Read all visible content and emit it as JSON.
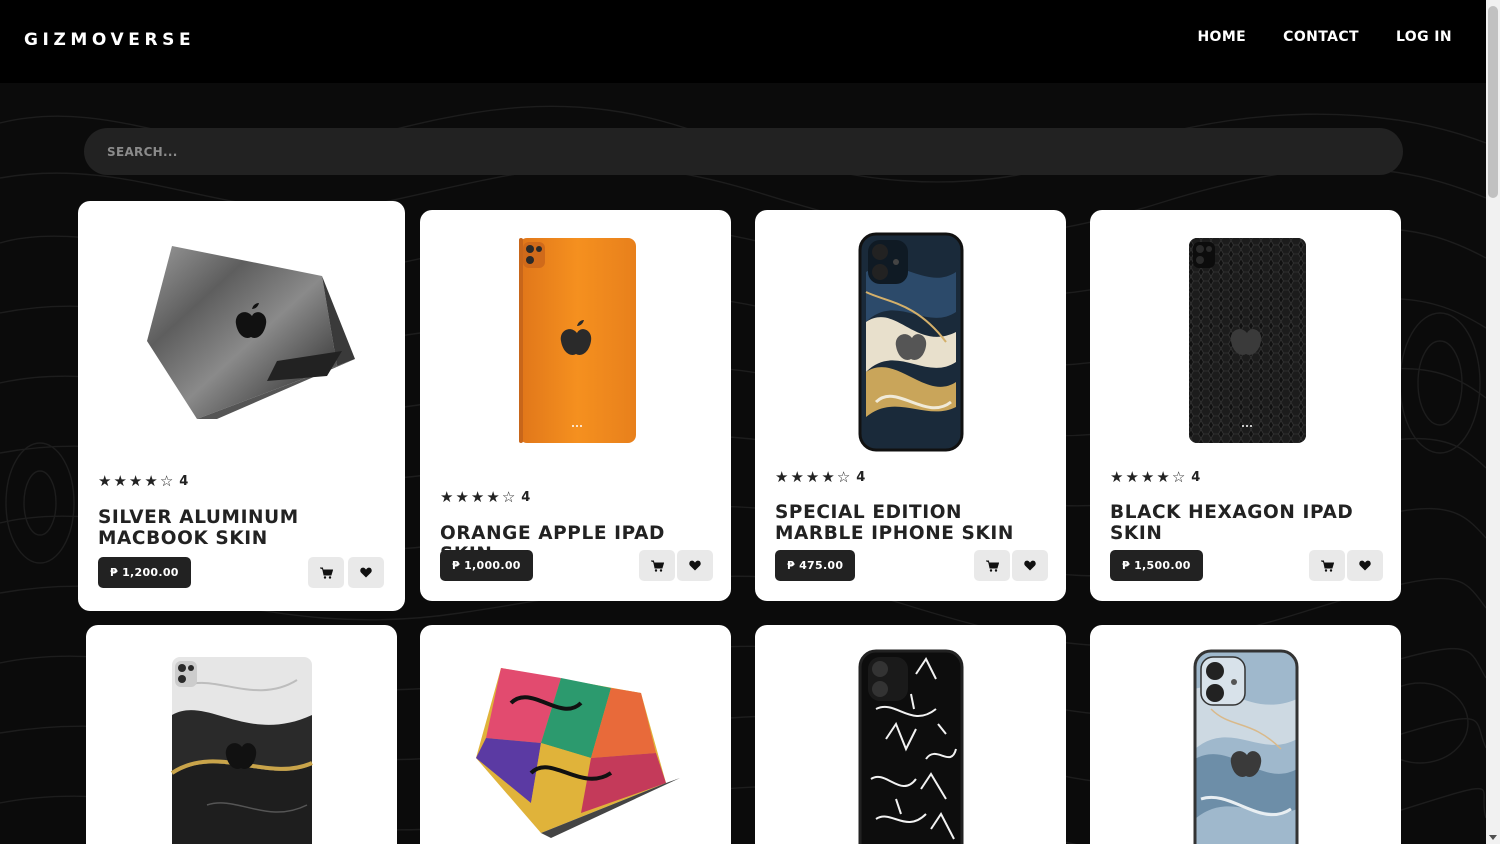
{
  "brand": {
    "name": "GIZMOVERSE"
  },
  "nav": {
    "items": [
      "HOME",
      "CONTACT",
      "LOG IN"
    ]
  },
  "search": {
    "placeholder": "SEARCH..."
  },
  "colors": {
    "page_bg": "#0a0a0a",
    "header_bg": "#000000",
    "card_bg": "#ffffff",
    "price_bg": "#222222",
    "action_bg": "#e9e9e9"
  },
  "products": [
    {
      "name": "SILVER ALUMINUM MACBOOK SKIN",
      "price": "₱ 1,200.00",
      "rating": 4,
      "rating_label": "4",
      "device": "laptop",
      "finish": "brushed silver"
    },
    {
      "name": "ORANGE APPLE IPAD SKIN",
      "price": "₱ 1,000.00",
      "rating": 4,
      "rating_label": "4",
      "device": "tablet",
      "finish": "orange"
    },
    {
      "name": "SPECIAL EDITION MARBLE IPHONE SKIN",
      "price": "₱ 475.00",
      "rating": 4,
      "rating_label": "4",
      "device": "phone",
      "finish": "blue gold marble"
    },
    {
      "name": "BLACK HEXAGON IPAD SKIN",
      "price": "₱ 1,500.00",
      "rating": 4,
      "rating_label": "4",
      "device": "tablet",
      "finish": "black hexagon"
    },
    {
      "name": "",
      "price": "",
      "rating": null,
      "device": "tablet",
      "finish": "white black gold marble"
    },
    {
      "name": "",
      "price": "",
      "rating": null,
      "device": "laptop",
      "finish": "graffiti"
    },
    {
      "name": "",
      "price": "",
      "rating": null,
      "device": "phone",
      "finish": "black white graffiti"
    },
    {
      "name": "",
      "price": "",
      "rating": null,
      "device": "phone",
      "finish": "blue marble"
    }
  ],
  "icons": {
    "cart": "cart-icon",
    "wishlist": "heart-icon",
    "rating_full": "star-filled-icon",
    "rating_empty": "star-empty-icon",
    "apple_logo": "apple-logo-icon"
  }
}
